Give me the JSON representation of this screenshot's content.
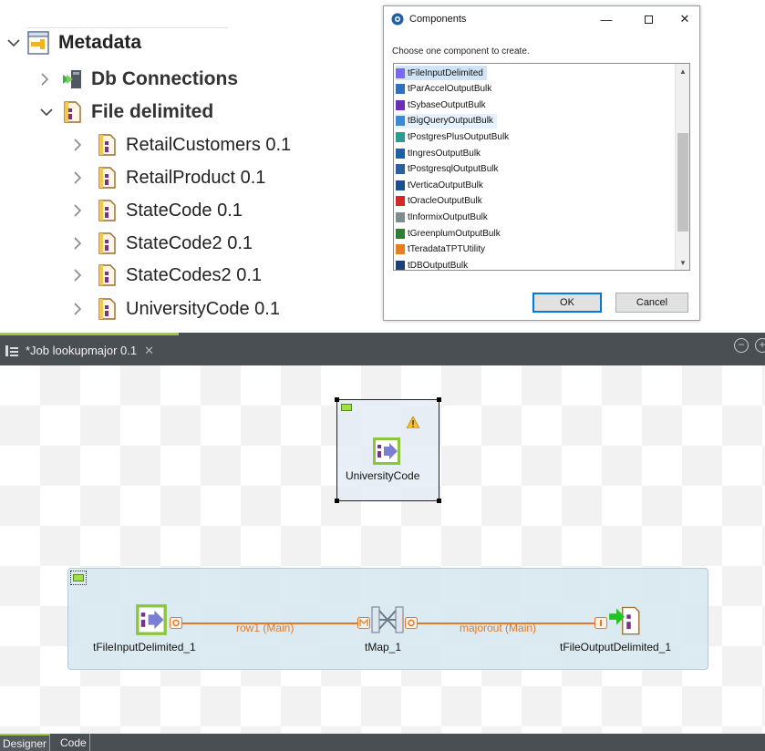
{
  "metadata_tree": {
    "root": {
      "label": "Metadata",
      "expanded": true
    },
    "db_connections": {
      "label": "Db Connections",
      "expanded": false
    },
    "file_delimited": {
      "label": "File delimited",
      "expanded": true,
      "items": [
        {
          "label": "RetailCustomers 0.1"
        },
        {
          "label": "RetailProduct 0.1"
        },
        {
          "label": "StateCode 0.1"
        },
        {
          "label": "StateCode2 0.1"
        },
        {
          "label": "StateCodes2 0.1"
        },
        {
          "label": "UniversityCode 0.1"
        }
      ]
    }
  },
  "components_dialog": {
    "title": "Components",
    "prompt": "Choose one component to create.",
    "items": [
      {
        "label": "tFileInputDelimited",
        "state": "selected",
        "icon_color": "#7b68ee"
      },
      {
        "label": "tParAccelOutputBulk",
        "state": "",
        "icon_color": "#2f6fbf"
      },
      {
        "label": "tSybaseOutputBulk",
        "state": "",
        "icon_color": "#6a2fb5"
      },
      {
        "label": "tBigQueryOutputBulk",
        "state": "hover",
        "icon_color": "#3b8ad8"
      },
      {
        "label": "tPostgresPlusOutputBulk",
        "state": "",
        "icon_color": "#2a9d8f"
      },
      {
        "label": "tIngresOutputBulk",
        "state": "",
        "icon_color": "#1f5fa8"
      },
      {
        "label": "tPostgresqlOutputBulk",
        "state": "",
        "icon_color": "#2b5f9e"
      },
      {
        "label": "tVerticaOutputBulk",
        "state": "",
        "icon_color": "#1d4f8f"
      },
      {
        "label": "tOracleOutputBulk",
        "state": "",
        "icon_color": "#d62828"
      },
      {
        "label": "tInformixOutputBulk",
        "state": "",
        "icon_color": "#7f8c8d"
      },
      {
        "label": "tGreenplumOutputBulk",
        "state": "",
        "icon_color": "#2e7d32"
      },
      {
        "label": "tTeradataTPTUtility",
        "state": "",
        "icon_color": "#e67e22"
      },
      {
        "label": "tDBOutputBulk",
        "state": "",
        "icon_color": "#1d3f7a"
      }
    ],
    "ok_label": "OK",
    "cancel_label": "Cancel"
  },
  "job_editor": {
    "tab_title": "*Job lookupmajor 0.1",
    "components": {
      "university_code": {
        "label": "UniversityCode"
      },
      "file_input": {
        "label": "tFileInputDelimited_1"
      },
      "tmap": {
        "label": "tMap_1"
      },
      "file_output": {
        "label": "tFileOutputDelimited_1"
      }
    },
    "links": {
      "row1": {
        "label": "row1 (Main)"
      },
      "majorout": {
        "label": "majorout (Main)"
      }
    },
    "bottom_tabs": [
      {
        "label": "Designer",
        "active": true
      },
      {
        "label": "Code",
        "active": false
      }
    ]
  },
  "colors": {
    "accent_green": "#9fcb3a",
    "link_orange": "#e07a2a",
    "selection_blue": "#cfe4f7"
  }
}
